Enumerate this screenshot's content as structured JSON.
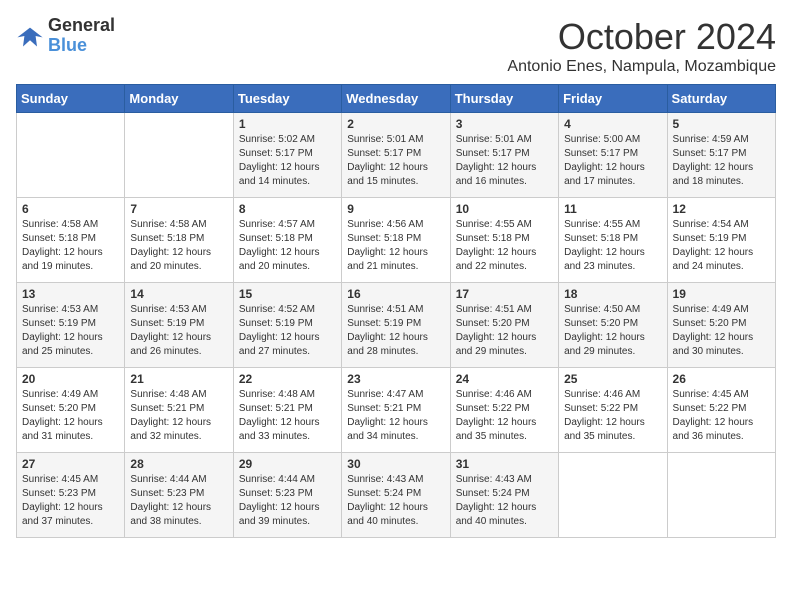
{
  "header": {
    "logo_line1": "General",
    "logo_line2": "Blue",
    "month": "October 2024",
    "location": "Antonio Enes, Nampula, Mozambique"
  },
  "days_of_week": [
    "Sunday",
    "Monday",
    "Tuesday",
    "Wednesday",
    "Thursday",
    "Friday",
    "Saturday"
  ],
  "weeks": [
    [
      {
        "day": "",
        "info": ""
      },
      {
        "day": "",
        "info": ""
      },
      {
        "day": "1",
        "info": "Sunrise: 5:02 AM\nSunset: 5:17 PM\nDaylight: 12 hours and 14 minutes."
      },
      {
        "day": "2",
        "info": "Sunrise: 5:01 AM\nSunset: 5:17 PM\nDaylight: 12 hours and 15 minutes."
      },
      {
        "day": "3",
        "info": "Sunrise: 5:01 AM\nSunset: 5:17 PM\nDaylight: 12 hours and 16 minutes."
      },
      {
        "day": "4",
        "info": "Sunrise: 5:00 AM\nSunset: 5:17 PM\nDaylight: 12 hours and 17 minutes."
      },
      {
        "day": "5",
        "info": "Sunrise: 4:59 AM\nSunset: 5:17 PM\nDaylight: 12 hours and 18 minutes."
      }
    ],
    [
      {
        "day": "6",
        "info": "Sunrise: 4:58 AM\nSunset: 5:18 PM\nDaylight: 12 hours and 19 minutes."
      },
      {
        "day": "7",
        "info": "Sunrise: 4:58 AM\nSunset: 5:18 PM\nDaylight: 12 hours and 20 minutes."
      },
      {
        "day": "8",
        "info": "Sunrise: 4:57 AM\nSunset: 5:18 PM\nDaylight: 12 hours and 20 minutes."
      },
      {
        "day": "9",
        "info": "Sunrise: 4:56 AM\nSunset: 5:18 PM\nDaylight: 12 hours and 21 minutes."
      },
      {
        "day": "10",
        "info": "Sunrise: 4:55 AM\nSunset: 5:18 PM\nDaylight: 12 hours and 22 minutes."
      },
      {
        "day": "11",
        "info": "Sunrise: 4:55 AM\nSunset: 5:18 PM\nDaylight: 12 hours and 23 minutes."
      },
      {
        "day": "12",
        "info": "Sunrise: 4:54 AM\nSunset: 5:19 PM\nDaylight: 12 hours and 24 minutes."
      }
    ],
    [
      {
        "day": "13",
        "info": "Sunrise: 4:53 AM\nSunset: 5:19 PM\nDaylight: 12 hours and 25 minutes."
      },
      {
        "day": "14",
        "info": "Sunrise: 4:53 AM\nSunset: 5:19 PM\nDaylight: 12 hours and 26 minutes."
      },
      {
        "day": "15",
        "info": "Sunrise: 4:52 AM\nSunset: 5:19 PM\nDaylight: 12 hours and 27 minutes."
      },
      {
        "day": "16",
        "info": "Sunrise: 4:51 AM\nSunset: 5:19 PM\nDaylight: 12 hours and 28 minutes."
      },
      {
        "day": "17",
        "info": "Sunrise: 4:51 AM\nSunset: 5:20 PM\nDaylight: 12 hours and 29 minutes."
      },
      {
        "day": "18",
        "info": "Sunrise: 4:50 AM\nSunset: 5:20 PM\nDaylight: 12 hours and 29 minutes."
      },
      {
        "day": "19",
        "info": "Sunrise: 4:49 AM\nSunset: 5:20 PM\nDaylight: 12 hours and 30 minutes."
      }
    ],
    [
      {
        "day": "20",
        "info": "Sunrise: 4:49 AM\nSunset: 5:20 PM\nDaylight: 12 hours and 31 minutes."
      },
      {
        "day": "21",
        "info": "Sunrise: 4:48 AM\nSunset: 5:21 PM\nDaylight: 12 hours and 32 minutes."
      },
      {
        "day": "22",
        "info": "Sunrise: 4:48 AM\nSunset: 5:21 PM\nDaylight: 12 hours and 33 minutes."
      },
      {
        "day": "23",
        "info": "Sunrise: 4:47 AM\nSunset: 5:21 PM\nDaylight: 12 hours and 34 minutes."
      },
      {
        "day": "24",
        "info": "Sunrise: 4:46 AM\nSunset: 5:22 PM\nDaylight: 12 hours and 35 minutes."
      },
      {
        "day": "25",
        "info": "Sunrise: 4:46 AM\nSunset: 5:22 PM\nDaylight: 12 hours and 35 minutes."
      },
      {
        "day": "26",
        "info": "Sunrise: 4:45 AM\nSunset: 5:22 PM\nDaylight: 12 hours and 36 minutes."
      }
    ],
    [
      {
        "day": "27",
        "info": "Sunrise: 4:45 AM\nSunset: 5:23 PM\nDaylight: 12 hours and 37 minutes."
      },
      {
        "day": "28",
        "info": "Sunrise: 4:44 AM\nSunset: 5:23 PM\nDaylight: 12 hours and 38 minutes."
      },
      {
        "day": "29",
        "info": "Sunrise: 4:44 AM\nSunset: 5:23 PM\nDaylight: 12 hours and 39 minutes."
      },
      {
        "day": "30",
        "info": "Sunrise: 4:43 AM\nSunset: 5:24 PM\nDaylight: 12 hours and 40 minutes."
      },
      {
        "day": "31",
        "info": "Sunrise: 4:43 AM\nSunset: 5:24 PM\nDaylight: 12 hours and 40 minutes."
      },
      {
        "day": "",
        "info": ""
      },
      {
        "day": "",
        "info": ""
      }
    ]
  ]
}
